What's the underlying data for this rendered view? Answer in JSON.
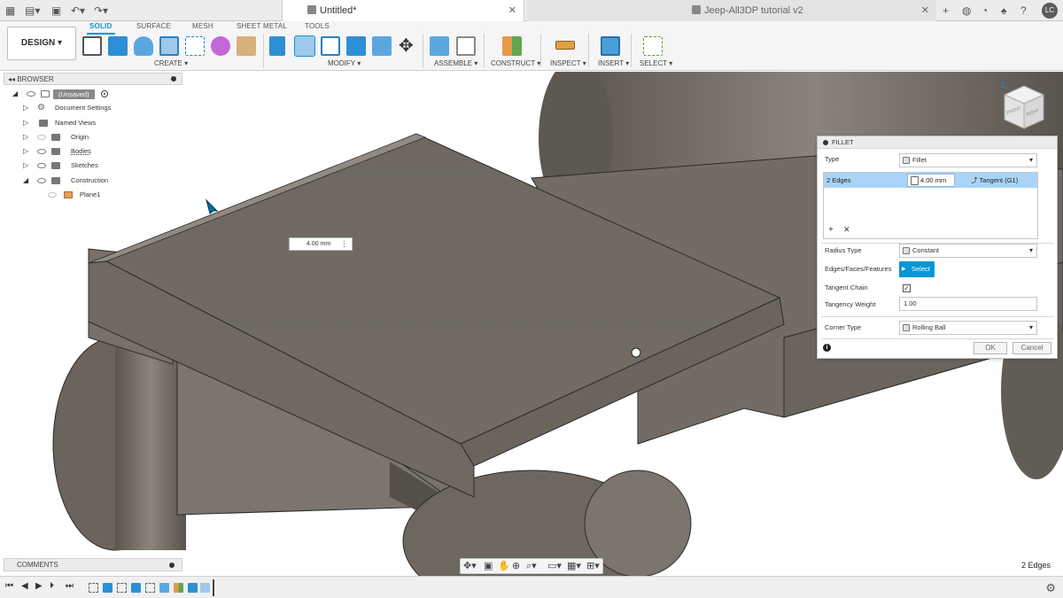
{
  "app": {
    "doc_tab_title": "Untitled*",
    "second_tab_title": "Jeep-All3DP tutorial v2",
    "user_initials": "LC"
  },
  "ribbon": {
    "design_label": "DESIGN ▾",
    "workspace_tabs": [
      "SOLID",
      "SURFACE",
      "MESH",
      "SHEET METAL",
      "TOOLS"
    ],
    "groups": [
      "CREATE ▾",
      "MODIFY ▾",
      "ASSEMBLE ▾",
      "CONSTRUCT ▾",
      "INSPECT ▾",
      "INSERT ▾",
      "SELECT ▾"
    ]
  },
  "browser": {
    "title": "BROWSER",
    "items": [
      {
        "label": "(Unsaved)"
      },
      {
        "label": "Document Settings"
      },
      {
        "label": "Named Views"
      },
      {
        "label": "Origin"
      },
      {
        "label": "Bodies"
      },
      {
        "label": "Sketches"
      },
      {
        "label": "Construction"
      },
      {
        "label": "Plane1"
      }
    ]
  },
  "comments": {
    "title": "COMMENTS"
  },
  "inline_input": {
    "value": "4.00 mm"
  },
  "fillet": {
    "title": "FILLET",
    "type_label": "Type",
    "type_value": "Fillet",
    "edges_label": "2 Edges",
    "edges_value": "4.00 mm",
    "tangent_label": "Tangent (G1)",
    "radius_type_label": "Radius Type",
    "radius_type_value": "Constant",
    "eff_label": "Edges/Faces/Features",
    "select_label": "Select",
    "tangent_chain_label": "Tangent Chain",
    "tangent_chain_checked": "✓",
    "tangency_weight_label": "Tangency Weight",
    "tangency_weight_value": "1.00",
    "corner_type_label": "Corner Type",
    "corner_type_value": "Rolling Ball",
    "ok_label": "OK",
    "cancel_label": "Cancel"
  },
  "viewcube": {
    "left_face": "FRONT",
    "right_face": "RIGHT",
    "axis": "Z"
  },
  "status": {
    "selection": "2 Edges"
  },
  "colors": {
    "accent": "#0696d7",
    "selection_row": "#a9d4f7",
    "model_gray": "#716b63"
  }
}
